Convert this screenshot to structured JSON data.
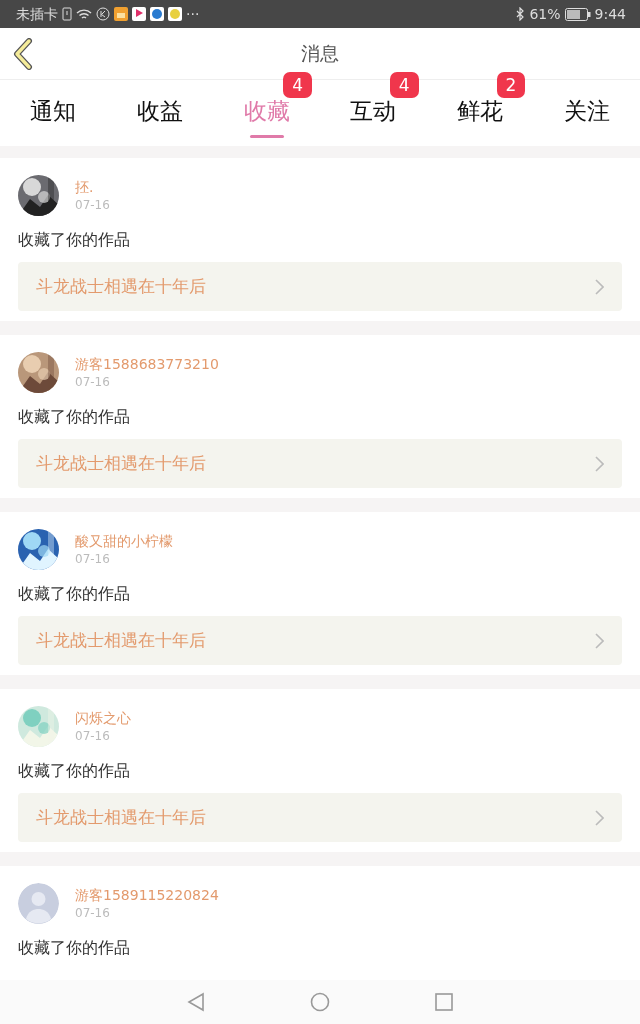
{
  "status_bar": {
    "carrier": "未插卡",
    "more": "···",
    "battery_text": "61%",
    "time": "9:44"
  },
  "header": {
    "title": "消息"
  },
  "tabs": [
    {
      "label": "通知",
      "selected": false
    },
    {
      "label": "收益",
      "selected": false
    },
    {
      "label": "收藏",
      "selected": true,
      "badge": "4"
    },
    {
      "label": "互动",
      "selected": false,
      "badge": "4"
    },
    {
      "label": "鲜花",
      "selected": false,
      "badge": "2"
    },
    {
      "label": "关注",
      "selected": false
    }
  ],
  "messages": [
    {
      "user": "抷.",
      "date": "07-16",
      "text": "收藏了你的作品",
      "work": "斗龙战士相遇在十年后"
    },
    {
      "user": "游客1588683773210",
      "date": "07-16",
      "text": "收藏了你的作品",
      "work": "斗龙战士相遇在十年后"
    },
    {
      "user": "酸又甜的小柠檬",
      "date": "07-16",
      "text": "收藏了你的作品",
      "work": "斗龙战士相遇在十年后"
    },
    {
      "user": "闪烁之心",
      "date": "07-16",
      "text": "收藏了你的作品",
      "work": "斗龙战士相遇在十年后"
    },
    {
      "avatar": {
        "kind": "default"
      },
      "user": "游客1589115220824",
      "date": "07-16",
      "text": "收藏了你的作品"
    }
  ]
}
